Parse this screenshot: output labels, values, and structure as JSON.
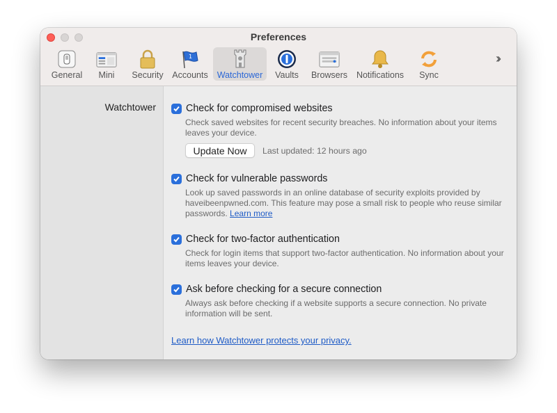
{
  "window": {
    "title": "Preferences"
  },
  "tabs": [
    {
      "label": "General",
      "icon": "general-icon"
    },
    {
      "label": "Mini",
      "icon": "mini-icon"
    },
    {
      "label": "Security",
      "icon": "lock-icon"
    },
    {
      "label": "Accounts",
      "icon": "accounts-icon"
    },
    {
      "label": "Watchtower",
      "icon": "watchtower-icon",
      "active": true
    },
    {
      "label": "Vaults",
      "icon": "vaults-icon"
    },
    {
      "label": "Browsers",
      "icon": "browsers-icon"
    },
    {
      "label": "Notifications",
      "icon": "bell-icon"
    },
    {
      "label": "Sync",
      "icon": "sync-icon"
    }
  ],
  "overflow_icon": "chevron-double-right-icon",
  "sidebar": {
    "section_label": "Watchtower"
  },
  "options": [
    {
      "title": "Check for compromised websites",
      "checked": true,
      "description": "Check saved websites for recent security breaches. No information about your items leaves your device."
    },
    {
      "title": "Check for vulnerable passwords",
      "checked": true,
      "description": "Look up saved passwords in an online database of security exploits provided by haveibeenpwned.com. This feature may pose a small risk to people who reuse similar passwords.",
      "link": "Learn more"
    },
    {
      "title": "Check for two-factor authentication",
      "checked": true,
      "description": "Check for login items that support two-factor authentication. No information about your items leaves your device."
    },
    {
      "title": "Ask before checking for a secure connection",
      "checked": true,
      "description": "Always ask before checking if a website supports a secure connection. No private information will be sent."
    }
  ],
  "update": {
    "button_label": "Update Now",
    "last_updated": "Last updated: 12 hours ago"
  },
  "footer_link": "Learn how Watchtower protects your privacy.",
  "colors": {
    "accent": "#2a6fdb",
    "link": "#1e5bc6",
    "close": "#fe5f57"
  }
}
